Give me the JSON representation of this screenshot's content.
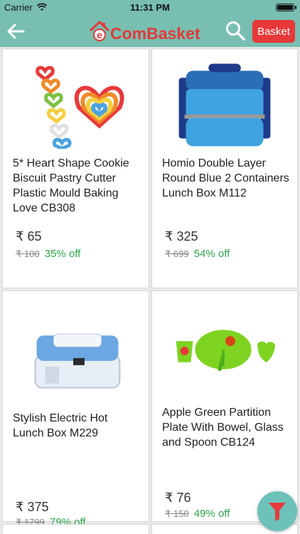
{
  "status_bar": {
    "carrier": "Carrier",
    "time": "11:31 PM"
  },
  "nav": {
    "logo_text": "ComBasket",
    "logo_letter": "e",
    "basket_label": "Basket"
  },
  "currency": "₹",
  "products": [
    {
      "title": "5* Heart Shape Cookie Biscuit Pastry Cutter Plastic Mould Baking Love CB308",
      "price": "₹ 65",
      "mrp": "₹ 100",
      "discount": "35% off",
      "image": "heart-cutters"
    },
    {
      "title": "Homio Double Layer Round Blue 2 Containers Lunch Box M112",
      "price": "₹ 325",
      "mrp": "₹ 699",
      "discount": "54% off",
      "image": "blue-lunchbox"
    },
    {
      "title": "Stylish Electric Hot Lunch Box M229",
      "price": "₹ 375",
      "mrp": "₹ 1799",
      "discount": "79% off",
      "image": "electric-lunchbox"
    },
    {
      "title": "Apple Green Partition Plate With Bowel, Glass and Spoon CB124",
      "price": "₹ 76",
      "mrp": "₹ 150",
      "discount": "49% off",
      "image": "green-plate-set"
    }
  ],
  "colors": {
    "header": "#78bfb1",
    "brand_red": "#e23a3a",
    "discount_green": "#2fa64d",
    "fab": "#6cc2ba",
    "filter_icon": "#e8393a"
  }
}
